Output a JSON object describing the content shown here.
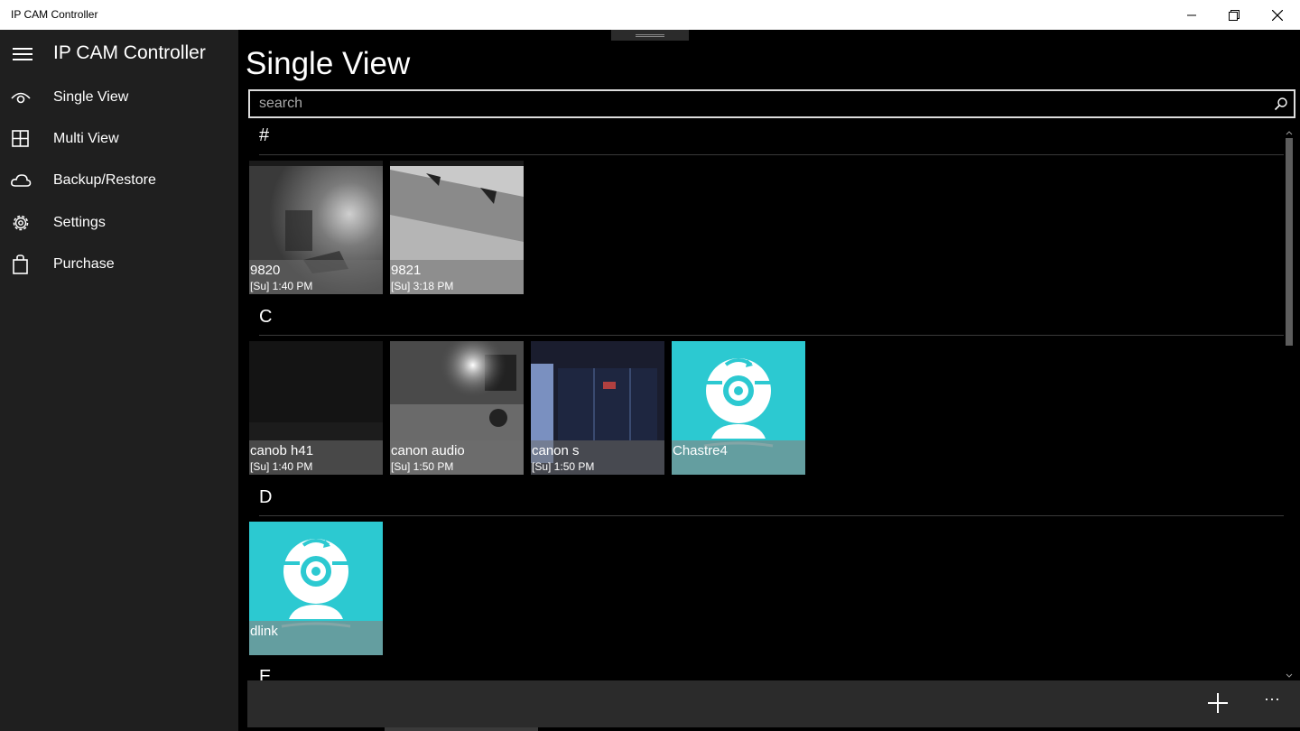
{
  "window": {
    "title": "IP CAM Controller"
  },
  "sidebar": {
    "app_name": "IP CAM Controller",
    "items": [
      {
        "label": "Single View",
        "icon": "eye-icon"
      },
      {
        "label": "Multi View",
        "icon": "grid-icon"
      },
      {
        "label": "Backup/Restore",
        "icon": "cloud-icon"
      },
      {
        "label": "Settings",
        "icon": "gear-icon"
      },
      {
        "label": "Purchase",
        "icon": "shopping-bag-icon"
      }
    ]
  },
  "main": {
    "title": "Single View",
    "search": {
      "placeholder": "search",
      "value": ""
    },
    "groups": [
      {
        "header": "#",
        "cameras": [
          {
            "name": "9820",
            "time": "[Su] 1:40 PM"
          },
          {
            "name": "9821",
            "time": "[Su] 3:18 PM"
          }
        ]
      },
      {
        "header": "C",
        "cameras": [
          {
            "name": "canob h41",
            "time": "[Su] 1:40 PM"
          },
          {
            "name": "canon audio",
            "time": "[Su] 1:50 PM"
          },
          {
            "name": "canon s",
            "time": "[Su] 1:50 PM"
          },
          {
            "name": "Chastre4",
            "time": ""
          }
        ]
      },
      {
        "header": "D",
        "cameras": [
          {
            "name": "dlink",
            "time": ""
          }
        ]
      },
      {
        "header": "E",
        "cameras": []
      }
    ]
  },
  "appbar": {
    "add_icon": "plus-icon",
    "more_label": "···"
  },
  "colors": {
    "accent": "#2cc9d1",
    "sidebar_bg": "#1f1f1f",
    "appbar_bg": "#2b2b2b"
  }
}
